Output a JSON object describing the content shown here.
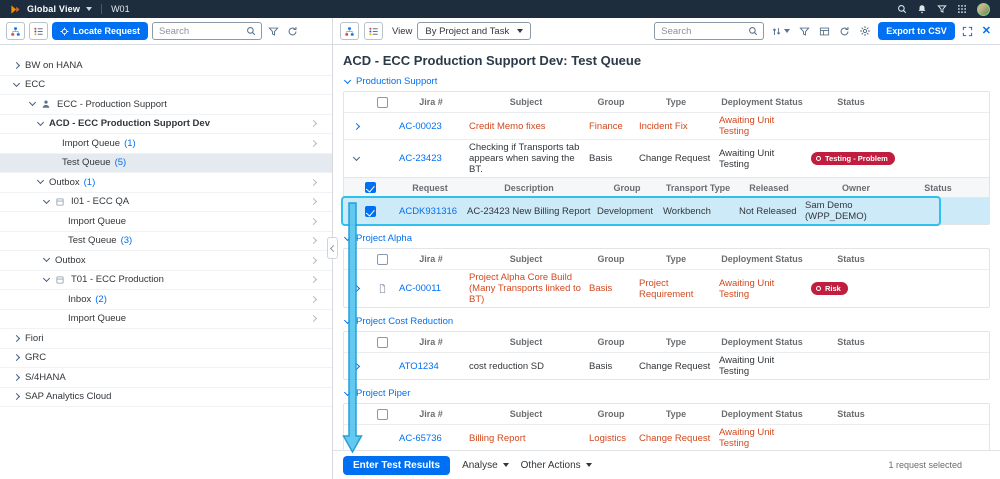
{
  "shell": {
    "app_name": "Global View",
    "system_id": "W01"
  },
  "toolbar_left": {
    "locate_request_label": "Locate Request",
    "search_placeholder": "Search"
  },
  "toolbar_right": {
    "view_label": "View",
    "view_selected": "By Project and Task",
    "search_placeholder": "Search",
    "export_csv_label": "Export to CSV"
  },
  "tree": {
    "items": [
      {
        "label": "BW on HANA",
        "count": ""
      },
      {
        "label": "ECC",
        "count": ""
      },
      {
        "label": "ECC - Production Support",
        "count": ""
      },
      {
        "label": "ACD - ECC Production Support Dev",
        "count": ""
      },
      {
        "label": "Import Queue",
        "count": "(1)"
      },
      {
        "label": "Test Queue",
        "count": "(5)"
      },
      {
        "label": "Outbox",
        "count": "(1)"
      },
      {
        "label": "I01 - ECC QA",
        "count": ""
      },
      {
        "label": "Import Queue",
        "count": ""
      },
      {
        "label": "Test Queue",
        "count": "(3)"
      },
      {
        "label": "Outbox",
        "count": ""
      },
      {
        "label": "T01 - ECC Production",
        "count": ""
      },
      {
        "label": "Inbox",
        "count": "(2)"
      },
      {
        "label": "Import Queue",
        "count": ""
      },
      {
        "label": "Fiori",
        "count": ""
      },
      {
        "label": "GRC",
        "count": ""
      },
      {
        "label": "S/4HANA",
        "count": ""
      },
      {
        "label": "SAP Analytics Cloud",
        "count": ""
      }
    ]
  },
  "main": {
    "title": "ACD - ECC Production Support Dev: Test Queue",
    "jira_columns": {
      "jira": "Jira #",
      "subject": "Subject",
      "group": "Group",
      "type": "Type",
      "deployment": "Deployment Status",
      "status": "Status"
    },
    "transport_columns": {
      "request": "Request",
      "description": "Description",
      "group": "Group",
      "transport_type": "Transport Type",
      "released": "Released",
      "owner": "Owner",
      "status": "Status"
    },
    "sections": [
      {
        "title": "Production Support",
        "rows": [
          {
            "jira": "AC-00023",
            "subject": "Credit Memo fixes",
            "group": "Finance",
            "type": "Incident Fix",
            "deployment": "Awaiting Unit Testing",
            "badge": ""
          },
          {
            "jira": "AC-23423",
            "subject": "Checking if Transports tab appears when saving the BT.",
            "group": "Basis",
            "type": "Change Request",
            "deployment": "Awaiting Unit Testing",
            "badge": "Testing - Problem"
          }
        ],
        "transports": [
          {
            "request": "ACDK931316",
            "description": "AC-23423 New Billing Report",
            "group": "Development",
            "transport_type": "Workbench",
            "released": "Not Released",
            "owner": "Sam Demo (WPP_DEMO)",
            "status": ""
          }
        ]
      },
      {
        "title": "Project Alpha",
        "rows": [
          {
            "jira": "AC-00011",
            "subject": "Project Alpha Core Build (Many Transports linked to BT)",
            "group": "Basis",
            "type": "Project Requirement",
            "deployment": "Awaiting Unit Testing",
            "badge": "Risk"
          }
        ]
      },
      {
        "title": "Project Cost Reduction",
        "rows": [
          {
            "jira": "ATO1234",
            "subject": "cost reduction SD",
            "group": "Basis",
            "type": "Change Request",
            "deployment": "Awaiting Unit Testing",
            "badge": ""
          }
        ]
      },
      {
        "title": "Project Piper",
        "rows": [
          {
            "jira": "AC-65736",
            "subject": "Billing Report",
            "group": "Logistics",
            "type": "Change Request",
            "deployment": "Awaiting Unit Testing",
            "badge": ""
          }
        ]
      }
    ]
  },
  "footer": {
    "enter_test_results_label": "Enter Test Results",
    "analyse_label": "Analyse",
    "other_actions_label": "Other Actions",
    "selection_status": "1 request selected"
  },
  "colors": {
    "accent_blue": "#0070f2",
    "shell_navy": "#1d2d3e",
    "overdue_red": "#d2491e",
    "badge_red": "#c11e3f",
    "annotation_cyan": "#2fc0ee",
    "selected_row_blue": "#cdeaf8"
  }
}
